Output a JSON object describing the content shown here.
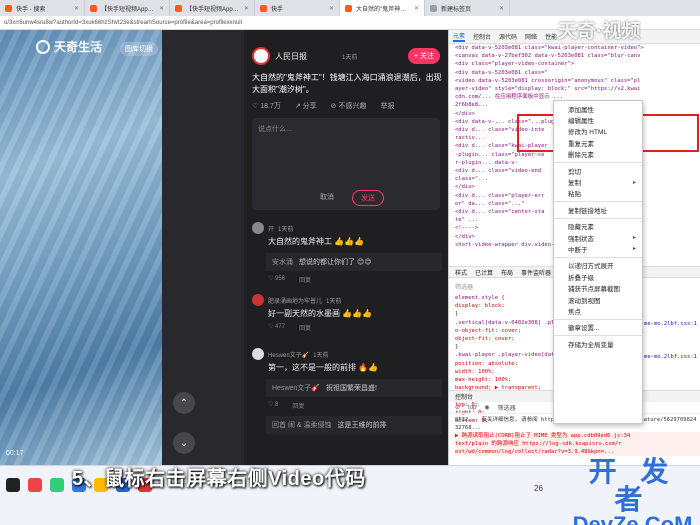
{
  "browser": {
    "tabs": [
      {
        "label": "快手 - 搜索",
        "active": false
      },
      {
        "label": "【快手短视频App】快手,",
        "active": false
      },
      {
        "label": "【快手短视频App】快手,",
        "active": false
      },
      {
        "label": "快手",
        "active": false
      },
      {
        "label": "大自然的\"鬼斧神工\"！钱塘",
        "active": true
      },
      {
        "label": "新建标签页",
        "active": false
      }
    ],
    "url": "o/3xrr6unw4sru8w?authorId=3xuk66hzShvt23e&streamSource=profile&area=profilexxnull"
  },
  "page": {
    "logo_text": "天奇生活",
    "switch_label": "图库切换",
    "video_time": "00:17",
    "author": {
      "name": "人民日报",
      "time": "1天前",
      "follow_label": "+ 关注"
    },
    "caption": "大自然的\"鬼斧神工\"！钱塘江入海口涌浪退潮后，出现大面积\"潮汐树\"。",
    "stats": {
      "likes": "18.7万",
      "share": "分享",
      "dislike": "不感兴趣",
      "more": "举报"
    },
    "comment_input_placeholder": "说点什么...",
    "cancel_label": "取消",
    "send_label": "发送",
    "comments": [
      {
        "user": "开",
        "time": "1天前",
        "text": "大自然的鬼斧神工 👍👍👍",
        "reply_user": "安水涌",
        "reply_text": "想说的都让你们了 😊😊",
        "likes": "956",
        "action": "回复"
      },
      {
        "user": "肥录涌画地为牢普儿",
        "time": "1天前",
        "text": "好一副天然的水墨画 👍👍👍",
        "likes": "477",
        "action": "回复"
      },
      {
        "user": "Heswen文子🎸",
        "time": "1天前",
        "text": "第一，这不是一般的前排 🔥👍",
        "reply_user": "Heswen文子🎸",
        "reply_text": "祝祖国繁荣昌盛!",
        "reply2_user": "回首 闹 & 温柔侵蚀",
        "reply2_text": "这是王维的前排",
        "likes": "8",
        "action": "回复"
      }
    ]
  },
  "devtools": {
    "tabs": [
      "元素",
      "控制台",
      "源代码",
      "网络",
      "性能"
    ],
    "code_lines": [
      "<div data-v-5203e081 class=\"kwai-player-container-video\">",
      "  <canvas data-v-27bef302 data-v-5203e081 class=\"blur-canv",
      "  <div class=\"player-video-container\">",
      "    <div data-v-5203e081 class=\"",
      "      <video data-v-5203e081 crossorigin=\"anonymous\" class=\"pl",
      "      ayer-video\" style=\"display: block;\" src=\"https://v2.kwai",
      "      cdn.com/... 在应用程序面板中显示 ...",
      "      2f6b8e8...",
      "    </div>",
      "    <div data-v-... class=\"...plugin\">",
      "      <div d... class=\"video-inte",
      "      ractiv...",
      "      <div d... class=\"kwai-player",
      "      -plugin... class=\"player-ce",
      "      r-plugin... data-v-",
      "      <div d... class=\"video-end",
      "      class=\"...",
      "    </div>",
      "    <div d... class=\"player-err",
      "    or\" da... class=\"...\"",
      "    <div d... class=\"center-sta",
      "    te\" ...",
      "  <!---->",
      "  </div>",
      "  short-video-wrapper  div.video-contai..."
    ],
    "styles_tabs": [
      "样式",
      "已计算",
      "布局",
      "事件监听器"
    ],
    "filter_label": "筛选器",
    "style_lines": [
      "element.style {",
      "  display: block;",
      "}",
      ".vertical[data-v-0402e308] .player-video {",
      "  o-object-fit: cover;",
      "  object-fit: cover;",
      "}",
      ".kwai-player .player-video[data-v-...] {",
      "  position: absolute;",
      "  width: 100%;",
      "  max-height: 100%;",
      "  background: ▶ transparent;",
      "  margin: ▶ auto;",
      "  top: 0;",
      "  right: 0;",
      "  bottom: 0;"
    ],
    "style_link": "me-mo.2lbf.css:1",
    "console_label": "控制台",
    "console_filter_items": [
      "top",
      "筛选器"
    ],
    "console_lines": [
      "8F32... 有关详细信息, 请参阅 https://www.chromestatus.com/feature/5629709824",
      "32768...",
      "▶ 跨源读取阻止(CORB)阻止了 MIME 类型为 app.cdb09ed6.js:34",
      "text/plain 的跨源响应 https://log-sdk.ksapisrv.com/r",
      "est/wd/common/log/collect/radar?v=3.9.48&kpn=..."
    ]
  },
  "context_menu": {
    "items": [
      {
        "label": "添加属性",
        "submenu": false
      },
      {
        "label": "编辑属性",
        "submenu": false
      },
      {
        "label": "修改为 HTML",
        "submenu": false
      },
      {
        "label": "重复元素",
        "submenu": false
      },
      {
        "label": "删除元素",
        "submenu": false
      },
      {
        "sep": true
      },
      {
        "label": "剪切",
        "submenu": false
      },
      {
        "label": "复制",
        "submenu": true
      },
      {
        "label": "粘贴",
        "submenu": false
      },
      {
        "sep": true
      },
      {
        "label": "复制链接地址",
        "submenu": false
      },
      {
        "sep": true
      },
      {
        "label": "隐藏元素",
        "submenu": false
      },
      {
        "label": "强制状态",
        "submenu": true
      },
      {
        "label": "中断于",
        "submenu": true
      },
      {
        "sep": true
      },
      {
        "label": "以递归方式展开",
        "submenu": false
      },
      {
        "label": "折叠子级",
        "submenu": false
      },
      {
        "label": "捕获节点屏幕截图",
        "submenu": false
      },
      {
        "label": "滚动到视图",
        "submenu": false
      },
      {
        "label": "焦点",
        "submenu": false
      },
      {
        "sep": true
      },
      {
        "label": "徽章设置...",
        "submenu": false
      },
      {
        "sep": true
      },
      {
        "label": "存储为全局变量",
        "submenu": false
      }
    ]
  },
  "overlays": {
    "step_caption": "5、鼠标右击屏幕右侧Video代码",
    "watermark_top": "天奇·视频",
    "watermark_bottom_1": "开 发 者",
    "watermark_bottom_2": "DevZe.CoM"
  },
  "taskbar": {
    "time": "26"
  }
}
